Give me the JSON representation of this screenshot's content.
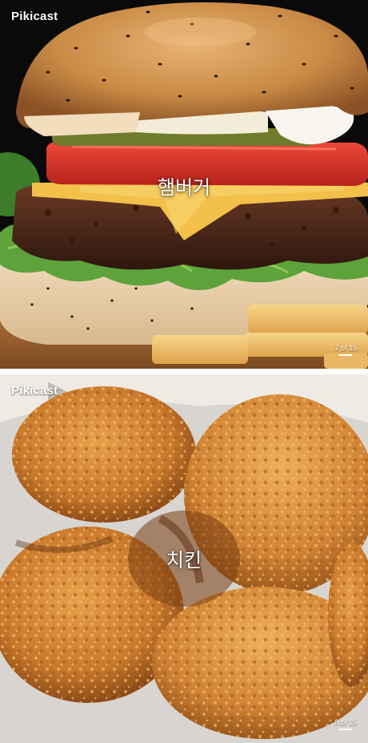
{
  "cards": [
    {
      "brand": "Pikicast",
      "caption": "햄버거",
      "counter": "7 of 15",
      "photo_icon": "hamburger-photo"
    },
    {
      "brand": "Pikicast",
      "caption": "치킨",
      "counter": "8 of 15",
      "photo_icon": "fried-chicken-photo"
    }
  ],
  "colors": {
    "bun": "#c98a45",
    "tomato": "#d9302a",
    "cheese": "#f3c04a",
    "lettuce": "#5da23a",
    "patty": "#4a2a1c",
    "fries": "#f0c26a",
    "chicken": "#c9792b"
  }
}
